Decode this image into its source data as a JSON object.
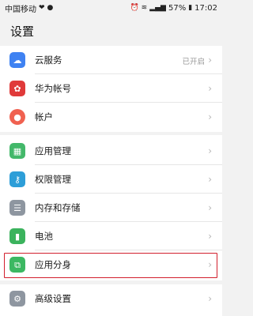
{
  "status_bar": {
    "carrier": "中国移动",
    "battery": "57%",
    "time": "17:02",
    "indicators": [
      "heart-icon",
      "wechat-icon",
      "alarm-icon",
      "wifi-icon",
      "signal-icon",
      "battery-icon"
    ]
  },
  "page": {
    "title": "设置"
  },
  "groups": [
    {
      "items": [
        {
          "label": "云服务",
          "value": "已开启",
          "icon": "cloud-icon",
          "color": "#3f82f2"
        },
        {
          "label": "华为帐号",
          "icon": "huawei-icon",
          "color": "#e03a3a"
        },
        {
          "label": "帐户",
          "icon": "account-icon",
          "color": "#f06150"
        }
      ]
    },
    {
      "items": [
        {
          "label": "应用管理",
          "icon": "apps-icon",
          "color": "#43b86a"
        },
        {
          "label": "权限管理",
          "icon": "key-icon",
          "color": "#2d9ed8"
        },
        {
          "label": "内存和存储",
          "icon": "storage-icon",
          "color": "#8e96a0"
        },
        {
          "label": "电池",
          "icon": "battery-icon",
          "color": "#3bb35d"
        },
        {
          "label": "应用分身",
          "icon": "app-twin-icon",
          "color": "#3cb862",
          "highlighted": true
        }
      ]
    },
    {
      "items": [
        {
          "label": "高级设置",
          "icon": "gear-icon",
          "color": "#8e96a0"
        }
      ]
    }
  ],
  "colors": {
    "highlight_border": "#d21f2d",
    "background": "#f2f2f2"
  }
}
